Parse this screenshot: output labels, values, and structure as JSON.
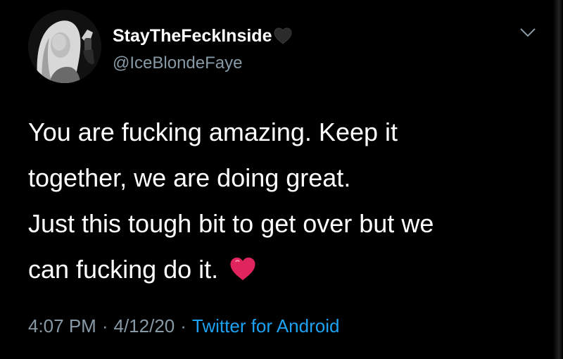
{
  "user": {
    "display_name": "StayTheFeckInside",
    "name_emoji": "black-heart-icon",
    "handle": "@IceBlondeFaye"
  },
  "tweet": {
    "lines": [
      "You are fucking amazing. Keep it",
      "together, we are doing great.",
      "Just this tough bit to get over but we",
      "can fucking do it."
    ],
    "end_emoji": "red-heart-icon"
  },
  "meta": {
    "time": "4:07 PM",
    "separator": "·",
    "date": "4/12/20",
    "source": "Twitter for Android"
  },
  "colors": {
    "background": "#000000",
    "text": "#ffffff",
    "secondary": "#8899a6",
    "link": "#1da1f2",
    "heart_red": "#e0245e"
  }
}
